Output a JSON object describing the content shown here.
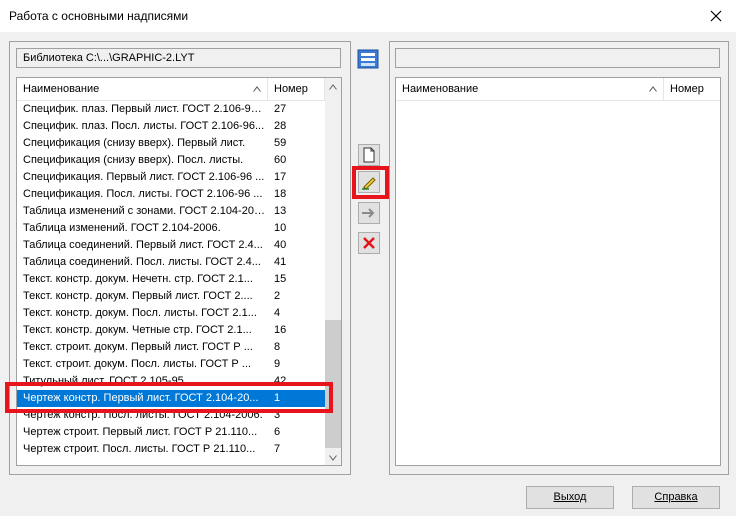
{
  "window": {
    "title": "Работа с основными надписями"
  },
  "library": {
    "label": "Библиотека C:\\...\\GRAPHIC-2.LYT"
  },
  "left_list": {
    "col_name": "Наименование",
    "col_num": "Номер",
    "rows": [
      {
        "name": "Специфик. плаз. Первый лист. ГОСТ 2.106-96...",
        "num": "27"
      },
      {
        "name": "Специфик. плаз. Посл. листы. ГОСТ 2.106-96...",
        "num": "28"
      },
      {
        "name": "Спецификация (снизу вверх). Первый лист.",
        "num": "59"
      },
      {
        "name": "Спецификация (снизу вверх). Посл. листы.",
        "num": "60"
      },
      {
        "name": "Спецификация. Первый лист. ГОСТ 2.106-96 ...",
        "num": "17"
      },
      {
        "name": "Спецификация. Посл. листы. ГОСТ 2.106-96 ...",
        "num": "18"
      },
      {
        "name": "Таблица изменений с зонами. ГОСТ 2.104-2006.",
        "num": "13"
      },
      {
        "name": "Таблица изменений. ГОСТ 2.104-2006.",
        "num": "10"
      },
      {
        "name": "Таблица соединений. Первый лист. ГОСТ 2.4...",
        "num": "40"
      },
      {
        "name": "Таблица соединений. Посл. листы. ГОСТ 2.4...",
        "num": "41"
      },
      {
        "name": "Текст. констр. докум. Нечетн. стр. ГОСТ 2.1...",
        "num": "15"
      },
      {
        "name": "Текст. констр. докум. Первый лист. ГОСТ 2....",
        "num": "2"
      },
      {
        "name": "Текст. констр. докум. Посл. листы. ГОСТ 2.1...",
        "num": "4"
      },
      {
        "name": "Текст. констр. докум. Четные стр. ГОСТ 2.1...",
        "num": "16"
      },
      {
        "name": "Текст. строит. докум. Первый лист. ГОСТ Р ...",
        "num": "8"
      },
      {
        "name": "Текст. строит. докум. Посл. листы. ГОСТ Р ...",
        "num": "9"
      },
      {
        "name": "Титульный лист. ГОСТ 2.105-95",
        "num": "42"
      },
      {
        "name": "Чертеж констр. Первый лист. ГОСТ 2.104-20...",
        "num": "1"
      },
      {
        "name": "Чертеж констр. Посл. листы. ГОСТ 2.104-2006.",
        "num": "3"
      },
      {
        "name": "Чертеж строит. Первый лист. ГОСТ Р 21.110...",
        "num": "6"
      },
      {
        "name": "Чертеж строит. Посл. листы. ГОСТ Р 21.110...",
        "num": "7"
      }
    ],
    "selected_index": 17
  },
  "right_list": {
    "col_name": "Наименование",
    "col_num": "Номер"
  },
  "buttons": {
    "exit": "Выход",
    "help": "Справка"
  }
}
